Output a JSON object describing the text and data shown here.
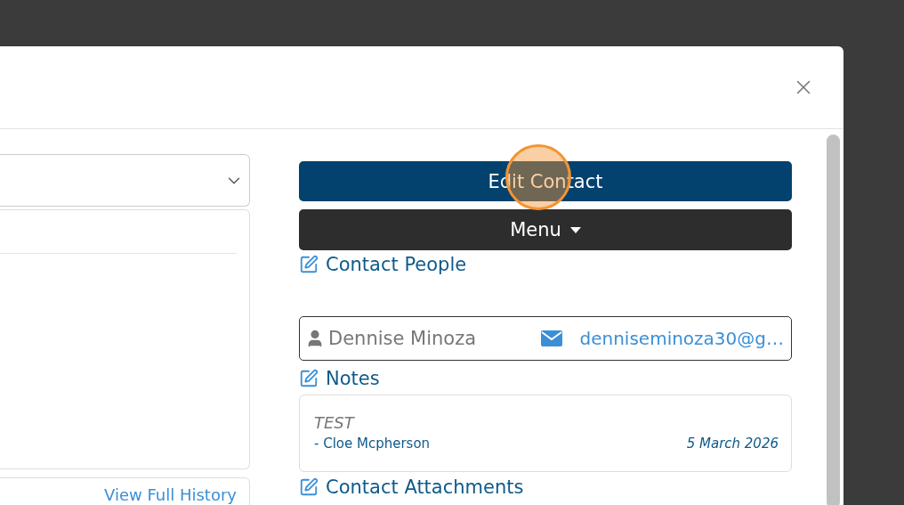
{
  "left_column": {
    "history_link": "View Full History"
  },
  "right_column": {
    "edit_button": "Edit Contact",
    "menu_button": "Menu",
    "contact_people_heading": "Contact People",
    "contacts": [
      {
        "name": "Dennise Minoza",
        "email": "denniseminoza30@g…"
      }
    ],
    "notes_heading": "Notes",
    "notes": [
      {
        "text": "TEST",
        "author": "- Cloe Mcpherson",
        "date": "5 March 2026"
      }
    ],
    "attachments_heading": "Contact Attachments"
  }
}
